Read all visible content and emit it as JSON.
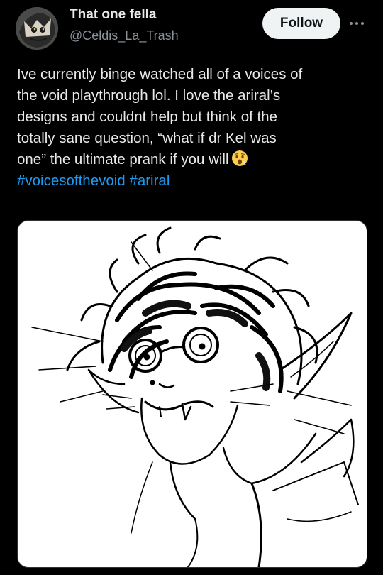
{
  "author": {
    "display_name": "That one fella",
    "handle": "@Celdis_La_Trash",
    "avatar_icon": "avatar-image"
  },
  "actions": {
    "follow_label": "Follow",
    "more_icon": "more-options-icon"
  },
  "tweet": {
    "lines": [
      "Ive currently binge watched all of a voices of",
      "the void playthrough lol. I love the ariral’s",
      "designs and couldnt help but think of the",
      "totally sane question, “what if dr Kel was",
      "one” the ultimate prank if you will"
    ],
    "emoji_icon": "face-with-open-mouth-emoji",
    "hashtags": [
      "#voicesofthevoid",
      "#ariral"
    ]
  },
  "media": {
    "type": "sketch-image",
    "subject": "ink sketch of a character with messy hair, round glasses and pointed ears"
  },
  "colors": {
    "background": "#000000",
    "text": "#e7e9ea",
    "secondary_text": "#8b9198",
    "link": "#1d9bf0",
    "follow_button_bg": "#eff3f4"
  }
}
